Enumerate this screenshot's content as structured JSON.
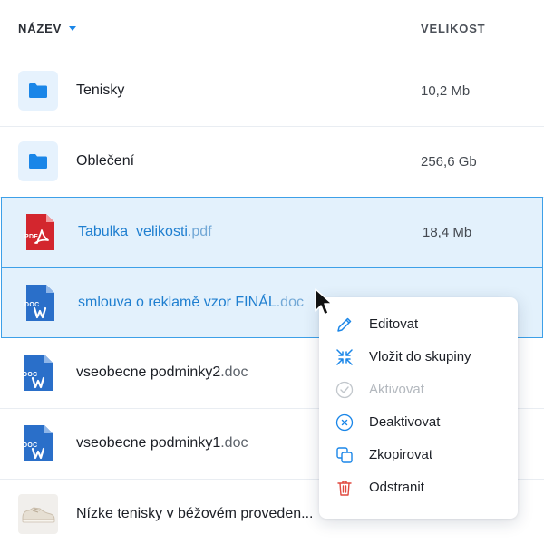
{
  "header": {
    "name_label": "NÁZEV",
    "size_label": "VELIKOST"
  },
  "files": [
    {
      "name": "Tenisky",
      "ext": "",
      "size": "10,2 Mb",
      "icon": "folder-icon",
      "selected": false
    },
    {
      "name": "Oblečení",
      "ext": "",
      "size": "256,6 Gb",
      "icon": "folder-icon",
      "selected": false
    },
    {
      "name": "Tabulka_velikosti",
      "ext": ".pdf",
      "size": "18,4 Mb",
      "icon": "pdf-file-icon",
      "badge": "PDF",
      "selected": true
    },
    {
      "name": "smlouva o reklamě vzor FINÁL",
      "ext": ".doc",
      "size": "",
      "icon": "word-file-icon",
      "badge": "DOC",
      "selected": true
    },
    {
      "name": "vseobecne podminky2",
      "ext": ".doc",
      "size": "",
      "icon": "word-file-icon",
      "badge": "DOC",
      "selected": false
    },
    {
      "name": "vseobecne podminky1",
      "ext": ".doc",
      "size": "",
      "icon": "word-file-icon",
      "badge": "DOC",
      "selected": false
    },
    {
      "name": "Nízke tenisky v béžovém proveden...",
      "ext": "",
      "size": "",
      "icon": "sneaker-thumbnail",
      "selected": false
    }
  ],
  "context_menu": {
    "items": [
      {
        "label": "Editovat",
        "icon": "pencil-icon",
        "disabled": false
      },
      {
        "label": "Vložit do skupiny",
        "icon": "group-arrows-icon",
        "disabled": false
      },
      {
        "label": "Aktivovat",
        "icon": "check-circle-icon",
        "disabled": true
      },
      {
        "label": "Deaktivovat",
        "icon": "x-circle-icon",
        "disabled": false
      },
      {
        "label": "Zkopirovat",
        "icon": "copy-icon",
        "disabled": false
      },
      {
        "label": "Odstranit",
        "icon": "trash-icon",
        "disabled": false
      }
    ]
  },
  "colors": {
    "accent": "#1a86e8",
    "selected_bg": "#e3f1fc",
    "selected_border": "#3da0e8",
    "pdf_red": "#d3262e",
    "word_blue": "#2a6fc9",
    "danger": "#e0483e",
    "disabled": "#b3b8be"
  }
}
